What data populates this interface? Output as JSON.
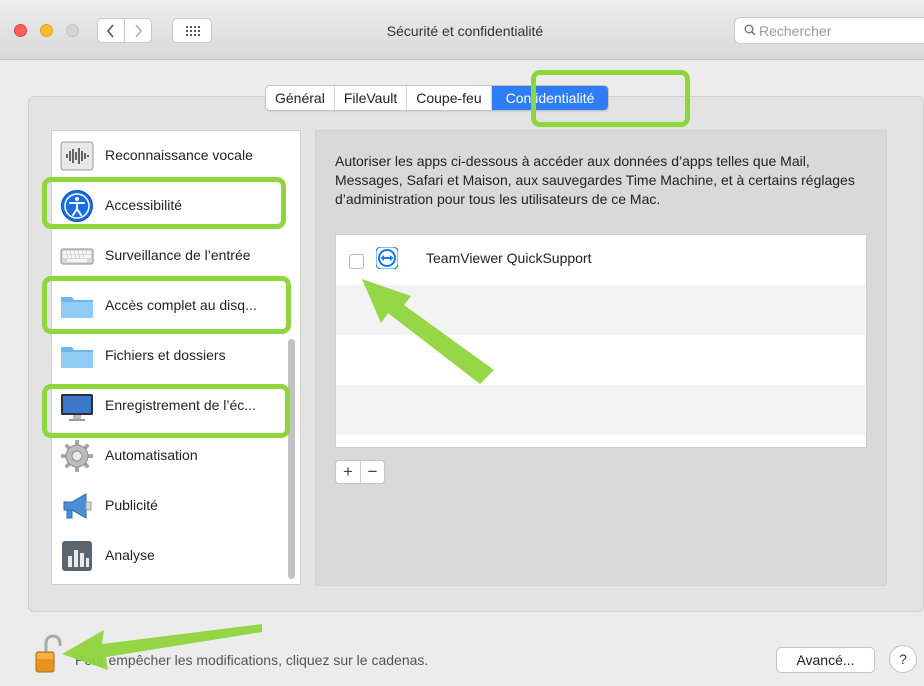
{
  "window": {
    "title": "Sécurité et confidentialité",
    "search_placeholder": "Rechercher"
  },
  "tabs": [
    {
      "label": "Général",
      "active": false
    },
    {
      "label": "FileVault",
      "active": false
    },
    {
      "label": "Coupe-feu",
      "active": false
    },
    {
      "label": "Confidentialité",
      "active": true
    }
  ],
  "sidebar": {
    "items": [
      {
        "label": "Reconnaissance vocale",
        "icon": "waveform-icon"
      },
      {
        "label": "Accessibilité",
        "icon": "accessibility-icon"
      },
      {
        "label": "Surveillance de l’entrée",
        "icon": "keyboard-icon"
      },
      {
        "label": "Accès complet au disq...",
        "icon": "folder-icon"
      },
      {
        "label": "Fichiers et dossiers",
        "icon": "folder-icon"
      },
      {
        "label": "Enregistrement de l’éc...",
        "icon": "display-icon"
      },
      {
        "label": "Automatisation",
        "icon": "gear-icon"
      },
      {
        "label": "Publicité",
        "icon": "megaphone-icon"
      },
      {
        "label": "Analyse",
        "icon": "bar-chart-icon"
      }
    ]
  },
  "content": {
    "description": "Autoriser les apps ci-dessous à accéder aux données d’apps telles que Mail, Messages, Safari et Maison, aux sauvegardes Time Machine, et à certains réglages d’administration pour tous les utilisateurs de ce Mac.",
    "apps": [
      {
        "name": "TeamViewer QuickSupport",
        "checked": false,
        "icon": "teamviewer-icon"
      }
    ],
    "add_label": "+",
    "remove_label": "−"
  },
  "footer": {
    "lock_text": "Pour empêcher les modifications, cliquez sur le cadenas.",
    "advanced_label": "Avancé...",
    "help_label": "?"
  },
  "colors": {
    "accent": "#2f7df6",
    "highlight": "#8fd53c"
  }
}
